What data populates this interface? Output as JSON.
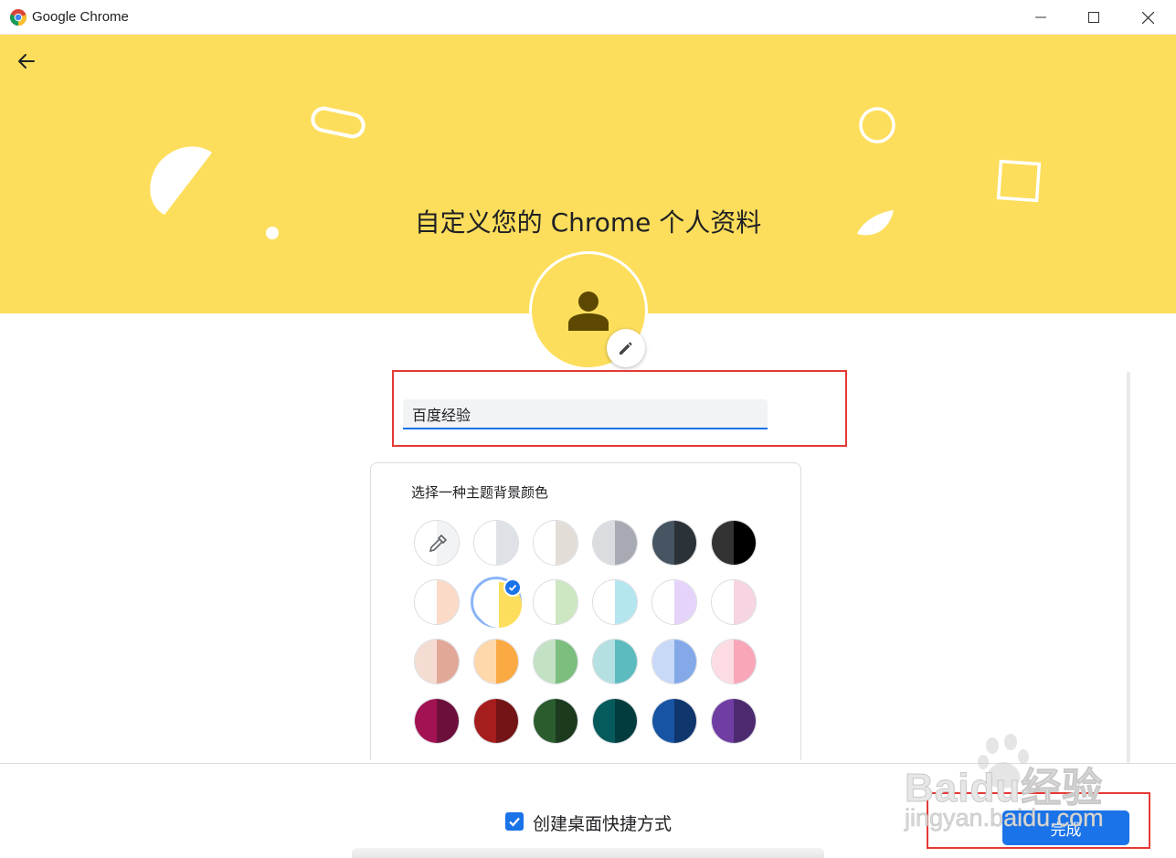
{
  "window": {
    "title": "Google Chrome",
    "minimize_icon": "minimize-icon",
    "maximize_icon": "maximize-icon",
    "close_icon": "close-icon"
  },
  "header": {
    "back_icon": "arrow-left-icon",
    "title": "自定义您的 Chrome 个人资料",
    "banner_color": "#fdde5c"
  },
  "profile": {
    "avatar_icon": "person-icon",
    "edit_icon": "pencil-icon",
    "name_value": "百度经验",
    "name_placeholder": ""
  },
  "theme": {
    "label": "选择一种主题背景颜色",
    "selected": "yellow",
    "swatches": [
      {
        "name": "custom-color-picker",
        "left": "#ffffff",
        "right": "#f1f3f4",
        "icon": "eyedropper-icon"
      },
      {
        "name": "default",
        "left": "#ffffff",
        "right": "#dee1e6"
      },
      {
        "name": "warm-grey",
        "left": "#ffffff",
        "right": "#e3ddd8"
      },
      {
        "name": "cool-grey",
        "left": "#dadce0",
        "right": "#a8aab3"
      },
      {
        "name": "midnight-blue",
        "left": "#465561",
        "right": "#2c3338"
      },
      {
        "name": "black",
        "left": "#333333",
        "right": "#000000"
      },
      {
        "name": "beige-peach",
        "left": "#ffffff",
        "right": "#fcdac8"
      },
      {
        "name": "yellow",
        "left": "#ffffff",
        "right": "#fdde5c"
      },
      {
        "name": "light-green",
        "left": "#ffffff",
        "right": "#cce7c2"
      },
      {
        "name": "light-teal",
        "left": "#ffffff",
        "right": "#b3e6ef"
      },
      {
        "name": "light-purple",
        "left": "#ffffff",
        "right": "#e6d3fa"
      },
      {
        "name": "light-pink",
        "left": "#ffffff",
        "right": "#f6d4e1"
      },
      {
        "name": "peach",
        "left": "#f5dcd3",
        "right": "#e2a897"
      },
      {
        "name": "orange",
        "left": "#fed8aa",
        "right": "#fbaa43"
      },
      {
        "name": "green",
        "left": "#c3e1c4",
        "right": "#7bbe7e"
      },
      {
        "name": "teal",
        "left": "#b4e0e1",
        "right": "#5bbbbe"
      },
      {
        "name": "blue",
        "left": "#c8d9f7",
        "right": "#84a9e8"
      },
      {
        "name": "pink",
        "left": "#fcdbe2",
        "right": "#f8a6b8"
      },
      {
        "name": "magenta",
        "left": "#a31252",
        "right": "#6d0f3b"
      },
      {
        "name": "red",
        "left": "#a61d1e",
        "right": "#741417"
      },
      {
        "name": "dark-green",
        "left": "#2a5c2d",
        "right": "#1b3a1e"
      },
      {
        "name": "dark-teal",
        "left": "#055a5c",
        "right": "#023c3e"
      },
      {
        "name": "dark-blue",
        "left": "#1754a3",
        "right": "#0f366d"
      },
      {
        "name": "violet",
        "left": "#703ea3",
        "right": "#4d2a70"
      }
    ]
  },
  "footer": {
    "shortcut_label": "创建桌面快捷方式",
    "shortcut_checked": true,
    "done_label": "完成"
  },
  "watermark": {
    "line1": "Baidu经验",
    "line2": "jingyan.baidu.com"
  }
}
